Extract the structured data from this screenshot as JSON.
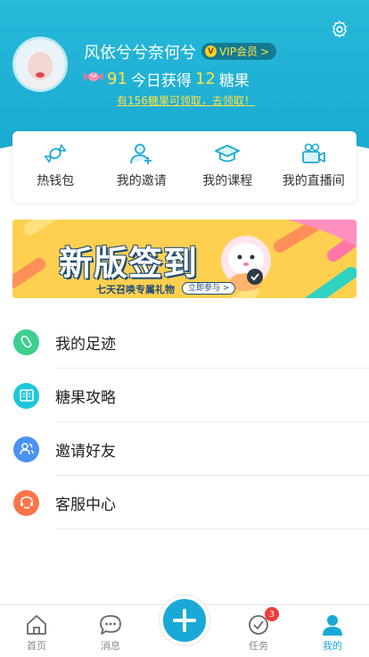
{
  "header": {
    "username": "风依兮兮奈何兮",
    "vip_label": "VIP会员",
    "vip_chevron": ">",
    "vip_letter": "V",
    "candy_count": "91",
    "today_prefix": "今日获得",
    "today_count": "12",
    "today_suffix": "糖果",
    "claim_text": "有156糖果可领取，去领取！",
    "settings_icon": "gear-icon"
  },
  "quick_menu": [
    {
      "label": "热钱包",
      "icon": "candy-wallet-icon"
    },
    {
      "label": "我的邀请",
      "icon": "user-add-icon"
    },
    {
      "label": "我的课程",
      "icon": "graduation-cap-icon"
    },
    {
      "label": "我的直播间",
      "icon": "video-camera-icon"
    }
  ],
  "banner": {
    "title": "新版签到",
    "subtitle": "七天召唤专属礼物",
    "button": "立即参与 >"
  },
  "list": [
    {
      "label": "我的足迹",
      "icon": "footprint-icon",
      "color": "#3ccf8e"
    },
    {
      "label": "糖果攻略",
      "icon": "book-icon",
      "color": "#1fc6d9"
    },
    {
      "label": "邀请好友",
      "icon": "users-icon",
      "color": "#4a93f5"
    },
    {
      "label": "客服中心",
      "icon": "headset-icon",
      "color": "#ff7448"
    }
  ],
  "tabbar": {
    "home": "首页",
    "messages": "消息",
    "tasks": "任务",
    "tasks_badge": "3",
    "mine": "我的"
  },
  "colors": {
    "accent": "#1aa9d6",
    "header": "#1fb0d4",
    "highlight": "#ffe14a",
    "badge": "#f23a3a"
  }
}
